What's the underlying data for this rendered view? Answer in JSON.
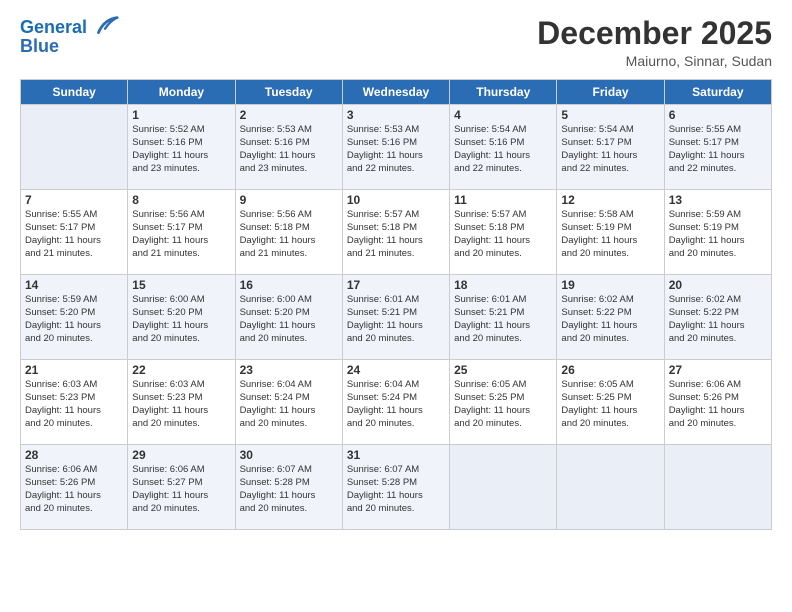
{
  "logo": {
    "line1": "General",
    "line2": "Blue"
  },
  "title": "December 2025",
  "location": "Maiurno, Sinnar, Sudan",
  "days_of_week": [
    "Sunday",
    "Monday",
    "Tuesday",
    "Wednesday",
    "Thursday",
    "Friday",
    "Saturday"
  ],
  "weeks": [
    [
      {
        "day": "",
        "sunrise": "",
        "sunset": "",
        "daylight": ""
      },
      {
        "day": "1",
        "sunrise": "Sunrise: 5:52 AM",
        "sunset": "Sunset: 5:16 PM",
        "daylight": "Daylight: 11 hours and 23 minutes."
      },
      {
        "day": "2",
        "sunrise": "Sunrise: 5:53 AM",
        "sunset": "Sunset: 5:16 PM",
        "daylight": "Daylight: 11 hours and 23 minutes."
      },
      {
        "day": "3",
        "sunrise": "Sunrise: 5:53 AM",
        "sunset": "Sunset: 5:16 PM",
        "daylight": "Daylight: 11 hours and 22 minutes."
      },
      {
        "day": "4",
        "sunrise": "Sunrise: 5:54 AM",
        "sunset": "Sunset: 5:16 PM",
        "daylight": "Daylight: 11 hours and 22 minutes."
      },
      {
        "day": "5",
        "sunrise": "Sunrise: 5:54 AM",
        "sunset": "Sunset: 5:17 PM",
        "daylight": "Daylight: 11 hours and 22 minutes."
      },
      {
        "day": "6",
        "sunrise": "Sunrise: 5:55 AM",
        "sunset": "Sunset: 5:17 PM",
        "daylight": "Daylight: 11 hours and 22 minutes."
      }
    ],
    [
      {
        "day": "7",
        "sunrise": "Sunrise: 5:55 AM",
        "sunset": "Sunset: 5:17 PM",
        "daylight": "Daylight: 11 hours and 21 minutes."
      },
      {
        "day": "8",
        "sunrise": "Sunrise: 5:56 AM",
        "sunset": "Sunset: 5:17 PM",
        "daylight": "Daylight: 11 hours and 21 minutes."
      },
      {
        "day": "9",
        "sunrise": "Sunrise: 5:56 AM",
        "sunset": "Sunset: 5:18 PM",
        "daylight": "Daylight: 11 hours and 21 minutes."
      },
      {
        "day": "10",
        "sunrise": "Sunrise: 5:57 AM",
        "sunset": "Sunset: 5:18 PM",
        "daylight": "Daylight: 11 hours and 21 minutes."
      },
      {
        "day": "11",
        "sunrise": "Sunrise: 5:57 AM",
        "sunset": "Sunset: 5:18 PM",
        "daylight": "Daylight: 11 hours and 20 minutes."
      },
      {
        "day": "12",
        "sunrise": "Sunrise: 5:58 AM",
        "sunset": "Sunset: 5:19 PM",
        "daylight": "Daylight: 11 hours and 20 minutes."
      },
      {
        "day": "13",
        "sunrise": "Sunrise: 5:59 AM",
        "sunset": "Sunset: 5:19 PM",
        "daylight": "Daylight: 11 hours and 20 minutes."
      }
    ],
    [
      {
        "day": "14",
        "sunrise": "Sunrise: 5:59 AM",
        "sunset": "Sunset: 5:20 PM",
        "daylight": "Daylight: 11 hours and 20 minutes."
      },
      {
        "day": "15",
        "sunrise": "Sunrise: 6:00 AM",
        "sunset": "Sunset: 5:20 PM",
        "daylight": "Daylight: 11 hours and 20 minutes."
      },
      {
        "day": "16",
        "sunrise": "Sunrise: 6:00 AM",
        "sunset": "Sunset: 5:20 PM",
        "daylight": "Daylight: 11 hours and 20 minutes."
      },
      {
        "day": "17",
        "sunrise": "Sunrise: 6:01 AM",
        "sunset": "Sunset: 5:21 PM",
        "daylight": "Daylight: 11 hours and 20 minutes."
      },
      {
        "day": "18",
        "sunrise": "Sunrise: 6:01 AM",
        "sunset": "Sunset: 5:21 PM",
        "daylight": "Daylight: 11 hours and 20 minutes."
      },
      {
        "day": "19",
        "sunrise": "Sunrise: 6:02 AM",
        "sunset": "Sunset: 5:22 PM",
        "daylight": "Daylight: 11 hours and 20 minutes."
      },
      {
        "day": "20",
        "sunrise": "Sunrise: 6:02 AM",
        "sunset": "Sunset: 5:22 PM",
        "daylight": "Daylight: 11 hours and 20 minutes."
      }
    ],
    [
      {
        "day": "21",
        "sunrise": "Sunrise: 6:03 AM",
        "sunset": "Sunset: 5:23 PM",
        "daylight": "Daylight: 11 hours and 20 minutes."
      },
      {
        "day": "22",
        "sunrise": "Sunrise: 6:03 AM",
        "sunset": "Sunset: 5:23 PM",
        "daylight": "Daylight: 11 hours and 20 minutes."
      },
      {
        "day": "23",
        "sunrise": "Sunrise: 6:04 AM",
        "sunset": "Sunset: 5:24 PM",
        "daylight": "Daylight: 11 hours and 20 minutes."
      },
      {
        "day": "24",
        "sunrise": "Sunrise: 6:04 AM",
        "sunset": "Sunset: 5:24 PM",
        "daylight": "Daylight: 11 hours and 20 minutes."
      },
      {
        "day": "25",
        "sunrise": "Sunrise: 6:05 AM",
        "sunset": "Sunset: 5:25 PM",
        "daylight": "Daylight: 11 hours and 20 minutes."
      },
      {
        "day": "26",
        "sunrise": "Sunrise: 6:05 AM",
        "sunset": "Sunset: 5:25 PM",
        "daylight": "Daylight: 11 hours and 20 minutes."
      },
      {
        "day": "27",
        "sunrise": "Sunrise: 6:06 AM",
        "sunset": "Sunset: 5:26 PM",
        "daylight": "Daylight: 11 hours and 20 minutes."
      }
    ],
    [
      {
        "day": "28",
        "sunrise": "Sunrise: 6:06 AM",
        "sunset": "Sunset: 5:26 PM",
        "daylight": "Daylight: 11 hours and 20 minutes."
      },
      {
        "day": "29",
        "sunrise": "Sunrise: 6:06 AM",
        "sunset": "Sunset: 5:27 PM",
        "daylight": "Daylight: 11 hours and 20 minutes."
      },
      {
        "day": "30",
        "sunrise": "Sunrise: 6:07 AM",
        "sunset": "Sunset: 5:28 PM",
        "daylight": "Daylight: 11 hours and 20 minutes."
      },
      {
        "day": "31",
        "sunrise": "Sunrise: 6:07 AM",
        "sunset": "Sunset: 5:28 PM",
        "daylight": "Daylight: 11 hours and 20 minutes."
      },
      {
        "day": "",
        "sunrise": "",
        "sunset": "",
        "daylight": ""
      },
      {
        "day": "",
        "sunrise": "",
        "sunset": "",
        "daylight": ""
      },
      {
        "day": "",
        "sunrise": "",
        "sunset": "",
        "daylight": ""
      }
    ]
  ]
}
